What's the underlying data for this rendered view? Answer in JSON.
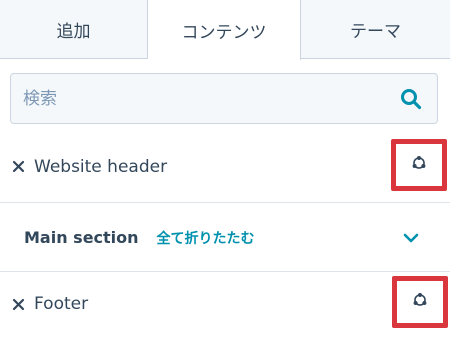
{
  "tabs": [
    {
      "label": "追加",
      "active": false
    },
    {
      "label": "コンテンツ",
      "active": true
    },
    {
      "label": "テーマ",
      "active": false
    }
  ],
  "search": {
    "placeholder": "検索",
    "value": ""
  },
  "rows": {
    "header": {
      "label": "Website header",
      "icon": "global-module-icon"
    },
    "section": {
      "label": "Main section",
      "collapse_all": "全て折りたたむ",
      "icon": "chevron-down-icon"
    },
    "footer": {
      "label": "Footer",
      "icon": "global-module-icon"
    }
  },
  "colors": {
    "accent": "#0091ae",
    "text": "#33475b",
    "highlight": "#d9363e",
    "tab_bg": "#f5f8fa",
    "border": "#cbd6e2"
  }
}
